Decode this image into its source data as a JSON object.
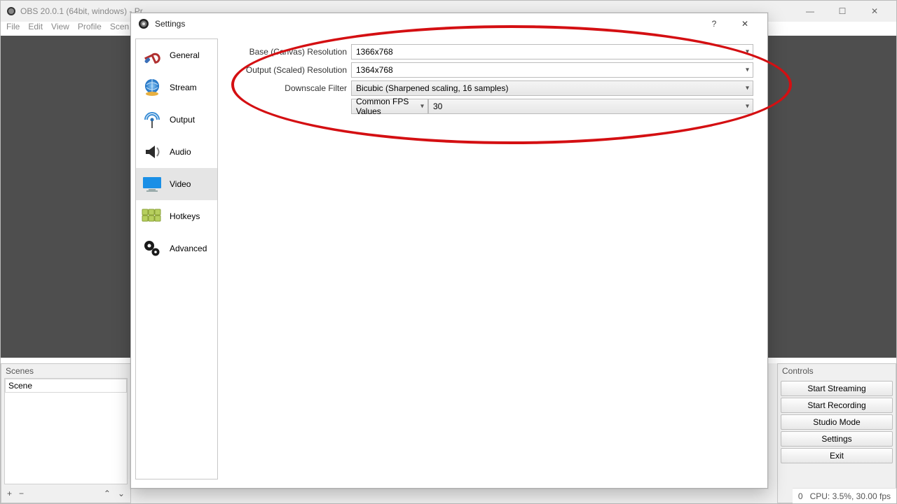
{
  "main": {
    "title": "OBS 20.0.1 (64bit, windows) - Pr",
    "menu": [
      "File",
      "Edit",
      "View",
      "Profile",
      "Scen"
    ]
  },
  "bottom": {
    "scenes_header": "Scenes",
    "scene_item": "Scene",
    "controls_header": "Controls",
    "buttons": {
      "start_streaming": "Start Streaming",
      "start_recording": "Start Recording",
      "studio_mode": "Studio Mode",
      "settings": "Settings",
      "exit": "Exit"
    },
    "status_right_num": "0",
    "status": "CPU: 3.5%, 30.00 fps"
  },
  "settings": {
    "title": "Settings",
    "sidebar": [
      {
        "label": "General",
        "key": "general"
      },
      {
        "label": "Stream",
        "key": "stream"
      },
      {
        "label": "Output",
        "key": "output"
      },
      {
        "label": "Audio",
        "key": "audio"
      },
      {
        "label": "Video",
        "key": "video"
      },
      {
        "label": "Hotkeys",
        "key": "hotkeys"
      },
      {
        "label": "Advanced",
        "key": "advanced"
      }
    ],
    "selected_key": "video",
    "video": {
      "base_label": "Base (Canvas) Resolution",
      "base_value": "1366x768",
      "output_label": "Output (Scaled) Resolution",
      "output_value": "1364x768",
      "filter_label": "Downscale Filter",
      "filter_value": "Bicubic (Sharpened scaling, 16 samples)",
      "fps_mode_label": "Common FPS Values",
      "fps_value": "30"
    },
    "help_symbol": "?",
    "close_symbol": "✕"
  },
  "window_controls": {
    "min": "—",
    "max": "☐",
    "close": "✕"
  },
  "tools": {
    "add": "+",
    "remove": "−",
    "up": "⌃",
    "down": "⌄"
  },
  "annotation": {
    "color": "#d40f12"
  }
}
